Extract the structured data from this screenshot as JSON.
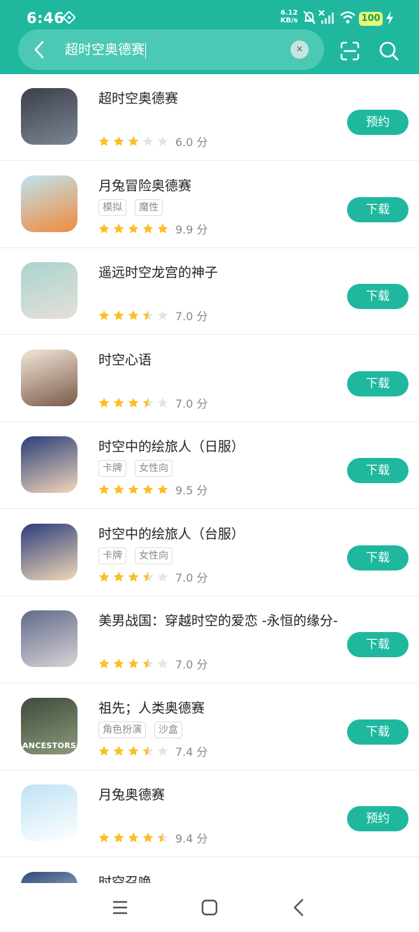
{
  "status_bar": {
    "time": "6:46",
    "net_speed_value": "6.12",
    "net_speed_unit": "KB/s",
    "battery": "100",
    "icons": [
      "vpn-diamond-icon",
      "mute-bell-icon",
      "signal-off-icon",
      "wifi-icon",
      "battery-icon",
      "charging-bolt-icon"
    ]
  },
  "search": {
    "query": "超时空奥德赛",
    "back_icon": "chevron-left-icon",
    "clear_icon": "clear-x-icon",
    "clear_label": "×",
    "scan_icon": "scan-icon",
    "search_icon": "search-icon"
  },
  "colors": {
    "accent": "#1fb89f",
    "star_on": "#fbbf24",
    "star_off": "#e5e5e5"
  },
  "results": [
    {
      "name": "超时空奥德赛",
      "tags": [],
      "stars": 3,
      "score": "6.0 分",
      "action": "预约"
    },
    {
      "name": "月兔冒险奥德赛",
      "tags": [
        "模拟",
        "魔性"
      ],
      "stars": 5,
      "score": "9.9 分",
      "action": "下载"
    },
    {
      "name": "遥远时空龙宫的神子",
      "tags": [],
      "stars": 3.5,
      "score": "7.0 分",
      "action": "下载"
    },
    {
      "name": "时空心语",
      "tags": [],
      "stars": 3.5,
      "score": "7.0 分",
      "action": "下载"
    },
    {
      "name": "时空中的绘旅人（日服）",
      "tags": [
        "卡牌",
        "女性向"
      ],
      "stars": 5,
      "score": "9.5 分",
      "action": "下载"
    },
    {
      "name": "时空中的绘旅人（台服）",
      "tags": [
        "卡牌",
        "女性向"
      ],
      "stars": 3.5,
      "score": "7.0 分",
      "action": "下载"
    },
    {
      "name": "美男战国：穿越时空的爱恋 -永恒的缘分-",
      "tags": [],
      "stars": 3.5,
      "score": "7.0 分",
      "action": "下载"
    },
    {
      "name": "祖先；人类奥德赛",
      "tags": [
        "角色扮演",
        "沙盒"
      ],
      "stars": 3.5,
      "score": "7.4 分",
      "action": "下载"
    },
    {
      "name": "月兔奥德赛",
      "tags": [],
      "stars": 4.5,
      "score": "9.4 分",
      "action": "预约"
    },
    {
      "name": "时空召唤",
      "tags": [],
      "stars": 0,
      "score": "",
      "action": ""
    }
  ],
  "result_icon_texts": [
    "",
    "",
    "",
    "",
    "",
    "",
    "",
    "ANCESTORS",
    "",
    ""
  ],
  "nav": {
    "icons": [
      "menu-icon",
      "home-square-icon",
      "back-triangle-icon"
    ]
  }
}
